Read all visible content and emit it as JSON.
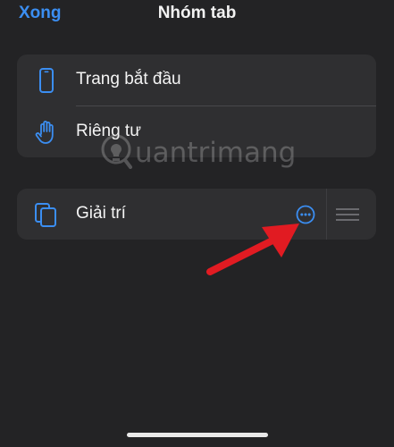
{
  "nav": {
    "done_label": "Xong",
    "title": "Nhóm tab"
  },
  "groups": [
    {
      "items": [
        {
          "label": "Trang bắt đầu",
          "icon": "phone-icon"
        },
        {
          "label": "Riêng tư",
          "icon": "hand-icon"
        }
      ]
    },
    {
      "items": [
        {
          "label": "Giải trí",
          "icon": "tabs-stack-icon",
          "action_icon": "more-circle-icon",
          "handle_icon": "drag-handle-icon"
        }
      ]
    }
  ],
  "watermark": {
    "text": "uantrimang"
  },
  "colors": {
    "background": "#232325",
    "card": "#2f2f31",
    "accent": "#3b8ef2",
    "arrow": "#e11b22"
  }
}
